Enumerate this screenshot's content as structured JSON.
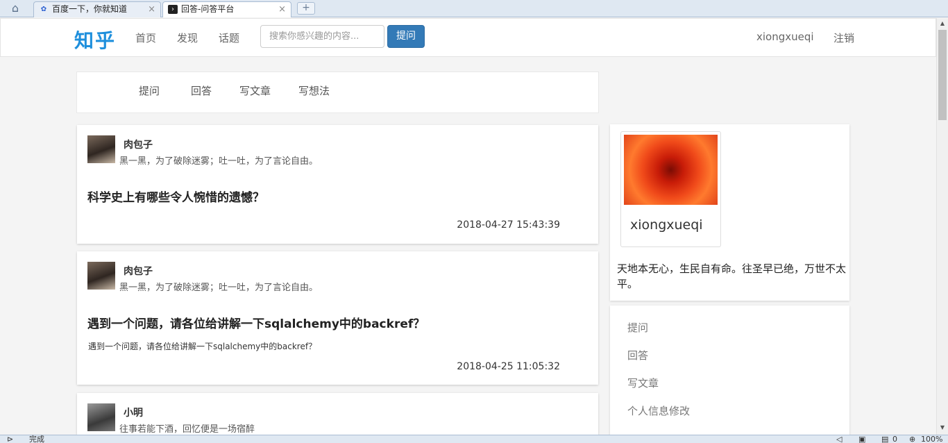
{
  "browser": {
    "tabs": [
      {
        "title": "百度一下，你就知道",
        "active": false,
        "icon": "baidu-paw-icon"
      },
      {
        "title": "回答-问答平台",
        "active": true,
        "icon": "terminal-icon"
      }
    ],
    "new_tab_glyph": "+",
    "close_glyph": "×",
    "home_glyph": "⌂"
  },
  "navbar": {
    "brand": "知乎",
    "links": [
      "首页",
      "发现",
      "话题"
    ],
    "search_placeholder": "搜索你感兴趣的内容...",
    "ask_button": "提问",
    "username": "xiongxueqi",
    "logout": "注销",
    "accent": "#337ab7",
    "brand_color": "#1e8fdc"
  },
  "quick_actions": [
    "提问",
    "回答",
    "写文章",
    "写想法"
  ],
  "questions": [
    {
      "author": "肉包子",
      "bio": "黑一黑，为了破除迷雾；吐一吐，为了言论自由。",
      "title": "科学史上有哪些令人惋惜的遗憾？",
      "body": "",
      "time": "2018-04-27 15:43:39"
    },
    {
      "author": "肉包子",
      "bio": "黑一黑，为了破除迷雾；吐一吐，为了言论自由。",
      "title": "遇到一个问题，请各位给讲解一下sqlalchemy中的backref？",
      "body": "遇到一个问题，请各位给讲解一下sqlalchemy中的backref？",
      "time": "2018-04-25 11:05:32"
    },
    {
      "author": "小明",
      "bio": "往事若能下酒，回忆便是一场宿醉",
      "title": "",
      "body": "",
      "time": ""
    }
  ],
  "profile": {
    "name": "xiongxueqi",
    "motto": "天地本无心，生民自有命。往圣早已绝，万世不太平。"
  },
  "sidebar_menu": [
    "提问",
    "回答",
    "写文章",
    "个人信息修改"
  ],
  "statusbar": {
    "status": "完成",
    "count": "0",
    "zoom": "100%"
  }
}
